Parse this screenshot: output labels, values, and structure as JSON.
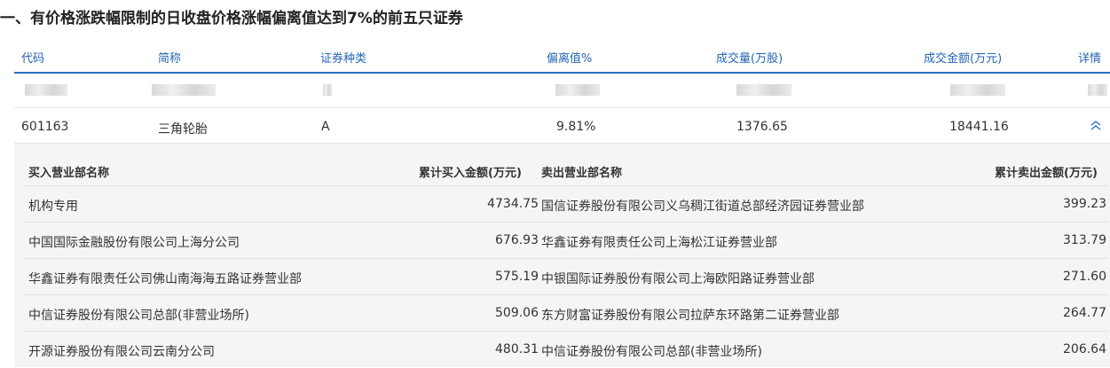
{
  "title": "一、有价格涨跌幅限制的日收盘价格涨幅偏离值达到7%的前五只证券",
  "columns": {
    "code": "代码",
    "name": "简称",
    "type": "证券种类",
    "deviation": "偏离值%",
    "volume": "成交量(万股)",
    "amount": "成交金额(万元)",
    "detail": "详情"
  },
  "stock": {
    "code": "601163",
    "name": "三角轮胎",
    "type": "A",
    "deviation": "9.81%",
    "volume": "1376.65",
    "amount": "18441.16"
  },
  "detail_headers": {
    "buy_name": "买入营业部名称",
    "buy_amount": "累计买入金额(万元)",
    "sell_name": "卖出营业部名称",
    "sell_amount": "累计卖出金额(万元)"
  },
  "detail_rows": [
    {
      "buy_name": "机构专用",
      "buy_amount": "4734.75",
      "sell_name": "国信证券股份有限公司义乌稠江街道总部经济园证券营业部",
      "sell_amount": "399.23"
    },
    {
      "buy_name": "中国国际金融股份有限公司上海分公司",
      "buy_amount": "676.93",
      "sell_name": "华鑫证券有限责任公司上海松江证券营业部",
      "sell_amount": "313.79"
    },
    {
      "buy_name": "华鑫证券有限责任公司佛山南海海五路证券营业部",
      "buy_amount": "575.19",
      "sell_name": "中银国际证券股份有限公司上海欧阳路证券营业部",
      "sell_amount": "271.60"
    },
    {
      "buy_name": "中信证券股份有限公司总部(非营业场所)",
      "buy_amount": "509.06",
      "sell_name": "东方财富证券股份有限公司拉萨东环路第二证券营业部",
      "sell_amount": "264.77"
    },
    {
      "buy_name": "开源证券股份有限公司云南分公司",
      "buy_amount": "480.31",
      "sell_name": "中信证券股份有限公司总部(非营业场所)",
      "sell_amount": "206.64"
    }
  ],
  "colors": {
    "accent": "#2b6fc1",
    "header_text": "#2565b5",
    "detail_bg": "#f5f5f5"
  },
  "icons": {
    "expand": "chevron-double-up-icon"
  }
}
